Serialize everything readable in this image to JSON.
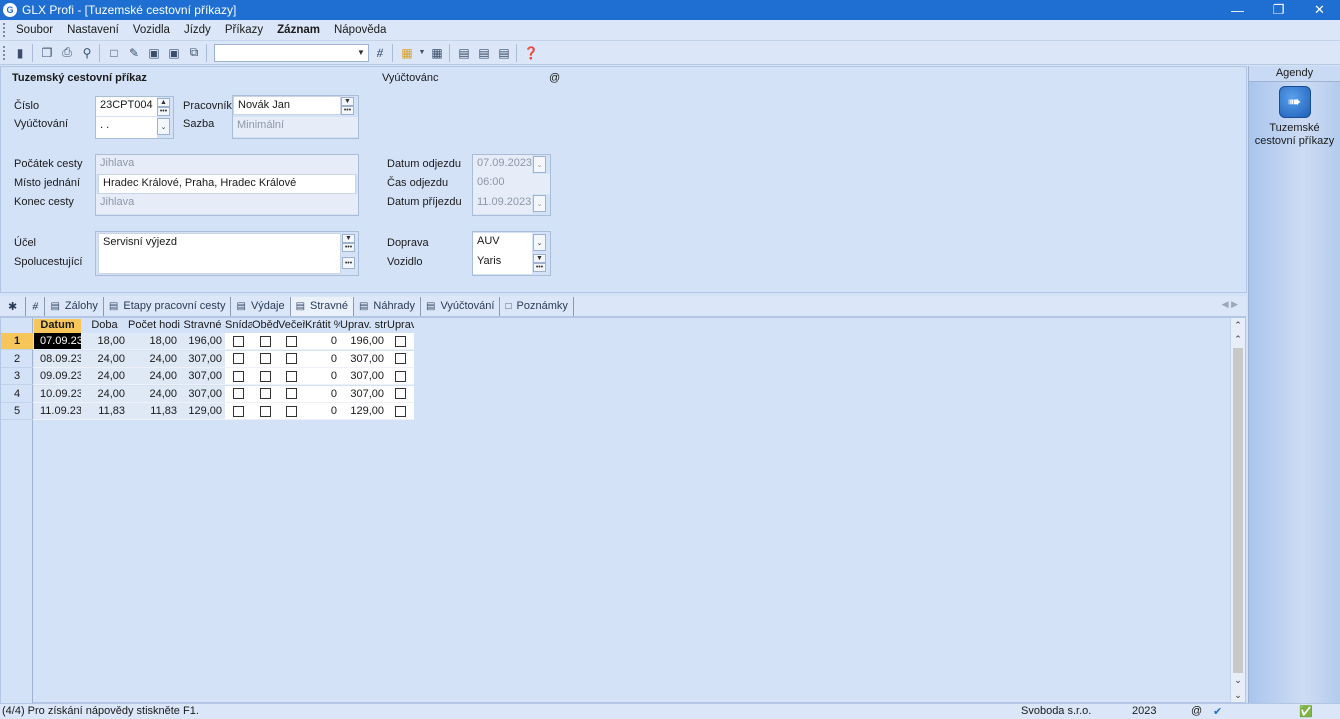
{
  "window": {
    "title": "GLX Profi - [Tuzemské cestovní příkazy]",
    "app_icon": "glx-logo-icon"
  },
  "menu": [
    {
      "label": "Soubor"
    },
    {
      "label": "Nastavení"
    },
    {
      "label": "Vozidla"
    },
    {
      "label": "Jízdy"
    },
    {
      "label": "Příkazy"
    },
    {
      "label": "Záznam",
      "active": true
    },
    {
      "label": "Nápověda"
    }
  ],
  "form": {
    "heading": "Tuzemský cestovní příkaz",
    "vyuctovanc_label": "Vyúčtovánc",
    "at_symbol": "@",
    "cislo_label": "Číslo",
    "cislo_value": "23CPT004",
    "vyuctovani_label": "Vyúčtování",
    "vyuctovani_value": " .  .",
    "pracovnik_label": "Pracovník",
    "pracovnik_value": "Novák Jan",
    "sazba_label": "Sazba",
    "sazba_value": "Minimální",
    "pocatek_label": "Počátek cesty",
    "pocatek_value": "Jihlava",
    "misto_label": "Místo jednání",
    "misto_value": "Hradec Králové, Praha, Hradec Králové",
    "konec_label": "Konec cesty",
    "konec_value": "Jihlava",
    "datum_odjezdu_label": "Datum odjezdu",
    "datum_odjezdu_value": "07.09.2023",
    "cas_odjezdu_label": "Čas odjezdu",
    "cas_odjezdu_value": "06:00",
    "datum_prijezdu_label": "Datum příjezdu",
    "datum_prijezdu_value": "11.09.2023",
    "ucel_label": "Účel",
    "ucel_value": "Servisní výjezd",
    "spolucestujici_label": "Spolucestující",
    "doprava_label": "Doprava",
    "doprava_value": "AUV",
    "vozidlo_label": "Vozidlo",
    "vozidlo_value": "Yaris"
  },
  "tabs": [
    {
      "label": "Zálohy"
    },
    {
      "label": "Etapy pracovní cesty"
    },
    {
      "label": "Výdaje"
    },
    {
      "label": "Stravné",
      "active": true
    },
    {
      "label": "Náhrady"
    },
    {
      "label": "Vyúčtování"
    },
    {
      "label": "Poznámky"
    }
  ],
  "grid": {
    "columns": [
      "Datum",
      "Doba",
      "Počet hodi",
      "Stravné",
      "Snída",
      "Oběd",
      "Večeř",
      "Krátit %",
      "Uprav. stra",
      "Uprav"
    ],
    "rows": [
      {
        "n": "1",
        "datum": "07.09.23",
        "doba": "18,00",
        "pocet": "18,00",
        "stravne": "196,00",
        "kratit": "0",
        "uprav": "196,00"
      },
      {
        "n": "2",
        "datum": "08.09.23",
        "doba": "24,00",
        "pocet": "24,00",
        "stravne": "307,00",
        "kratit": "0",
        "uprav": "307,00"
      },
      {
        "n": "3",
        "datum": "09.09.23",
        "doba": "24,00",
        "pocet": "24,00",
        "stravne": "307,00",
        "kratit": "0",
        "uprav": "307,00"
      },
      {
        "n": "4",
        "datum": "10.09.23",
        "doba": "24,00",
        "pocet": "24,00",
        "stravne": "307,00",
        "kratit": "0",
        "uprav": "307,00"
      },
      {
        "n": "5",
        "datum": "11.09.23",
        "doba": "11,83",
        "pocet": "11,83",
        "stravne": "129,00",
        "kratit": "0",
        "uprav": "129,00"
      }
    ]
  },
  "agendy": {
    "header": "Agendy",
    "item_line1": "Tuzemské",
    "item_line2": "cestovní příkazy"
  },
  "status": {
    "help": "(4/4) Pro získání nápovědy stiskněte F1.",
    "company": "Svoboda s.r.o.",
    "year": "2023",
    "at": "@"
  }
}
